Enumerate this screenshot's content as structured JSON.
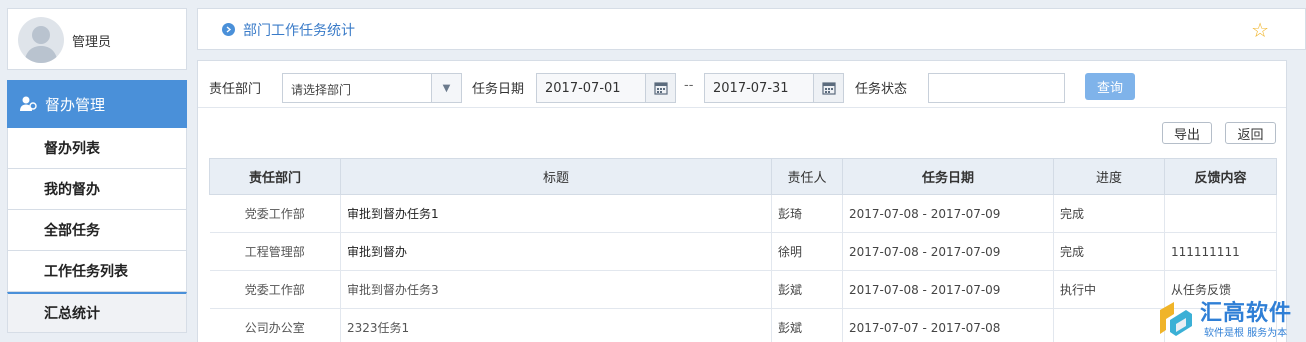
{
  "user": {
    "name": "管理员"
  },
  "nav": {
    "header": "督办管理",
    "items": [
      {
        "label": "督办列表"
      },
      {
        "label": "我的督办"
      },
      {
        "label": "全部任务"
      },
      {
        "label": "工作任务列表"
      },
      {
        "label": "汇总统计"
      }
    ]
  },
  "topbar": {
    "title": "部门工作任务统计"
  },
  "filters": {
    "dept_label": "责任部门",
    "dept_placeholder": "请选择部门",
    "date_label": "任务日期",
    "date_from": "2017-07-01",
    "date_sep": "--",
    "date_to": "2017-07-31",
    "status_label": "任务状态",
    "status_value": "",
    "query_button": "查询"
  },
  "actions": {
    "export": "导出",
    "back": "返回"
  },
  "table": {
    "headers": [
      "责任部门",
      "标题",
      "责任人",
      "任务日期",
      "进度",
      "反馈内容"
    ],
    "rows": [
      {
        "dept": "党委工作部",
        "title": "审批到督办任务1",
        "owner": "彭琦",
        "date": "2017-07-08 - 2017-07-09",
        "progress": "完成",
        "feedback": ""
      },
      {
        "dept": "工程管理部",
        "title": "审批到督办",
        "owner": "徐明",
        "date": "2017-07-08 - 2017-07-09",
        "progress": "完成",
        "feedback": "111111111"
      },
      {
        "dept": "党委工作部",
        "title": "审批到督办任务3",
        "owner": "彭斌",
        "date": "2017-07-08 - 2017-07-09",
        "progress": "执行中",
        "feedback": "从任务反馈"
      },
      {
        "dept": "公司办公室",
        "title": "2323任务1",
        "owner": "彭斌",
        "date": "2017-07-07 - 2017-07-08",
        "progress": "",
        "feedback": ""
      }
    ]
  },
  "watermark": {
    "brand": "汇高软件",
    "slogan": "软件是根 服务为本"
  },
  "colors": {
    "accent": "#4a90d9",
    "query_button": "#7fb3ea",
    "header_bg": "#e8eef5"
  }
}
